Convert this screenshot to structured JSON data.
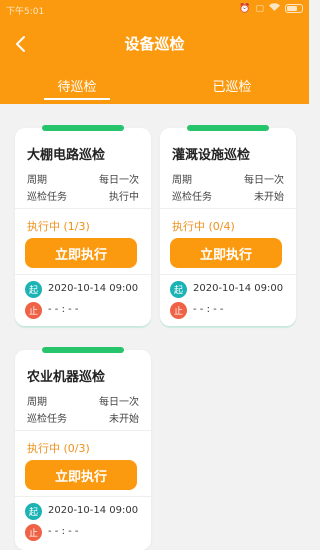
{
  "status_bar": {
    "time": "下午5:01",
    "icons": [
      "alarm-icon",
      "sim-icon",
      "wifi-icon",
      "battery-icon"
    ]
  },
  "header": {
    "title": "设备巡检",
    "back_icon": "chevron-left-icon"
  },
  "tabs": [
    {
      "label": "待巡检",
      "active": true
    },
    {
      "label": "已巡检",
      "active": false
    }
  ],
  "labels": {
    "period": "周期",
    "task": "巡检任务",
    "execute": "立即执行",
    "start_badge": "起",
    "stop_badge": "止"
  },
  "cards": [
    {
      "title": "大棚电路巡检",
      "period_value": "每日一次",
      "task_value": "执行中",
      "progress": "执行中 (1/3)",
      "start_time": "2020-10-14 09:00",
      "end_time": "- - : - -"
    },
    {
      "title": "灌溉设施巡检",
      "period_value": "每日一次",
      "task_value": "未开始",
      "progress": "执行中 (0/4)",
      "start_time": "2020-10-14 09:00",
      "end_time": "- - : - -"
    },
    {
      "title": "农业机器巡检",
      "period_value": "每日一次",
      "task_value": "未开始",
      "progress": "执行中 (0/3)",
      "start_time": "2020-10-14 09:00",
      "end_time": "- - : - -"
    }
  ],
  "colors": {
    "primary": "#fb9a0f",
    "green_bar": "#26c56b",
    "start_badge": "#1cb3b5",
    "stop_badge": "#ef6246",
    "progress_text": "#f0911e"
  }
}
